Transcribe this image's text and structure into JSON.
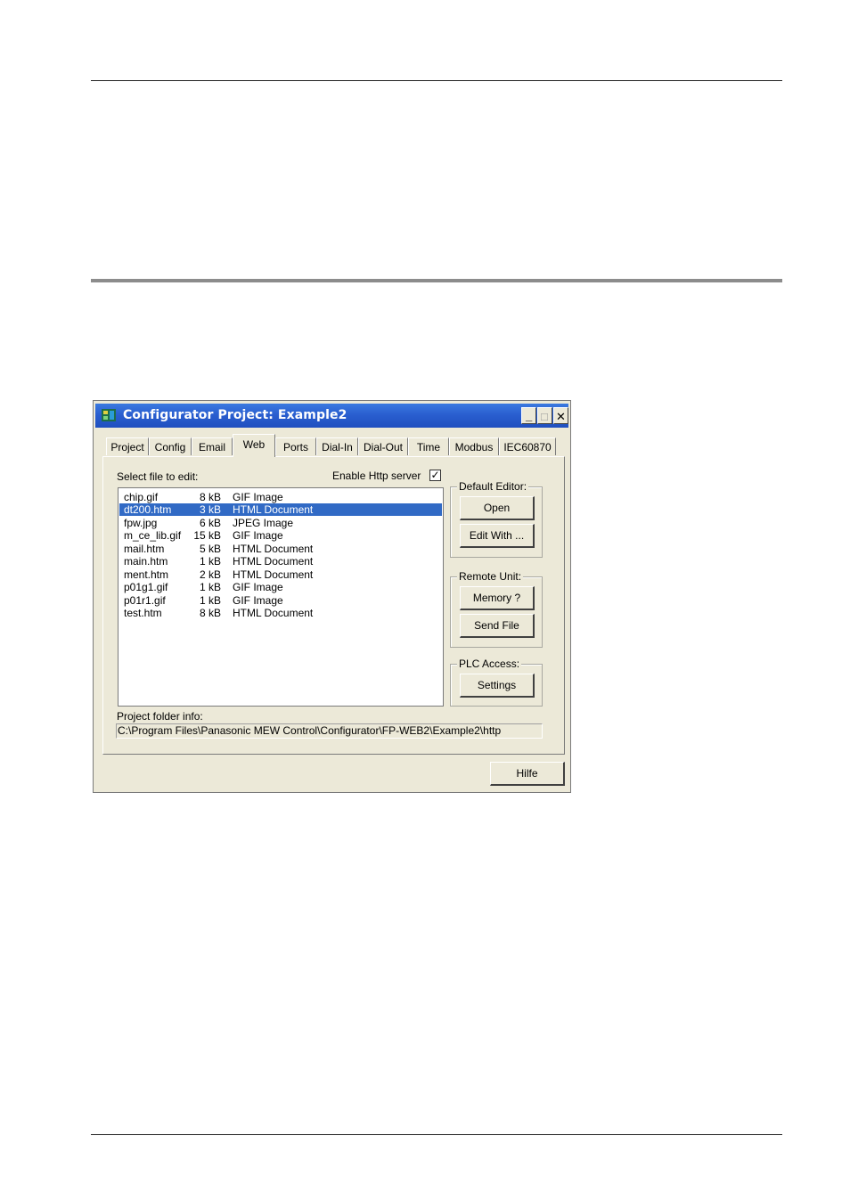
{
  "window": {
    "title": "Configurator Project: Example2",
    "min_glyph": "_",
    "max_glyph": "□",
    "close_glyph": "✕"
  },
  "tabs": [
    {
      "label": "Project"
    },
    {
      "label": "Config"
    },
    {
      "label": "Email"
    },
    {
      "label": "Web",
      "active": true
    },
    {
      "label": "Ports"
    },
    {
      "label": "Dial-In"
    },
    {
      "label": "Dial-Out"
    },
    {
      "label": "Time"
    },
    {
      "label": "Modbus"
    },
    {
      "label": "IEC60870"
    }
  ],
  "web": {
    "select_label": "Select file to edit:",
    "enable_http_label": "Enable Http server",
    "enable_http_checked": true,
    "checkbox_glyph": "✓",
    "files": [
      {
        "name": "chip.gif",
        "size": "8 kB",
        "type": "GIF Image"
      },
      {
        "name": "dt200.htm",
        "size": "3 kB",
        "type": "HTML Document",
        "selected": true
      },
      {
        "name": "fpw.jpg",
        "size": "6 kB",
        "type": "JPEG Image"
      },
      {
        "name": "m_ce_lib.gif",
        "size": "15 kB",
        "type": "GIF Image"
      },
      {
        "name": "mail.htm",
        "size": "5 kB",
        "type": "HTML Document"
      },
      {
        "name": "main.htm",
        "size": "1 kB",
        "type": "HTML Document"
      },
      {
        "name": "ment.htm",
        "size": "2 kB",
        "type": "HTML Document"
      },
      {
        "name": "p01g1.gif",
        "size": "1 kB",
        "type": "GIF Image"
      },
      {
        "name": "p01r1.gif",
        "size": "1 kB",
        "type": "GIF Image"
      },
      {
        "name": "test.htm",
        "size": "8 kB",
        "type": "HTML Document"
      }
    ],
    "default_editor": {
      "title": "Default Editor:",
      "open": "Open",
      "edit_with": "Edit With ..."
    },
    "remote_unit": {
      "title": "Remote Unit:",
      "memory": "Memory ?",
      "send_file": "Send File"
    },
    "plc_access": {
      "title": "PLC Access:",
      "settings": "Settings"
    },
    "folder_label": "Project folder info:",
    "folder_path": "C:\\Program Files\\Panasonic MEW Control\\Configurator\\FP-WEB2\\Example2\\http"
  },
  "footer": {
    "help": "Hilfe"
  },
  "colors": {
    "titlebar": "#2a5fd0",
    "selection": "#316ac5",
    "dialog": "#ece9d8"
  }
}
